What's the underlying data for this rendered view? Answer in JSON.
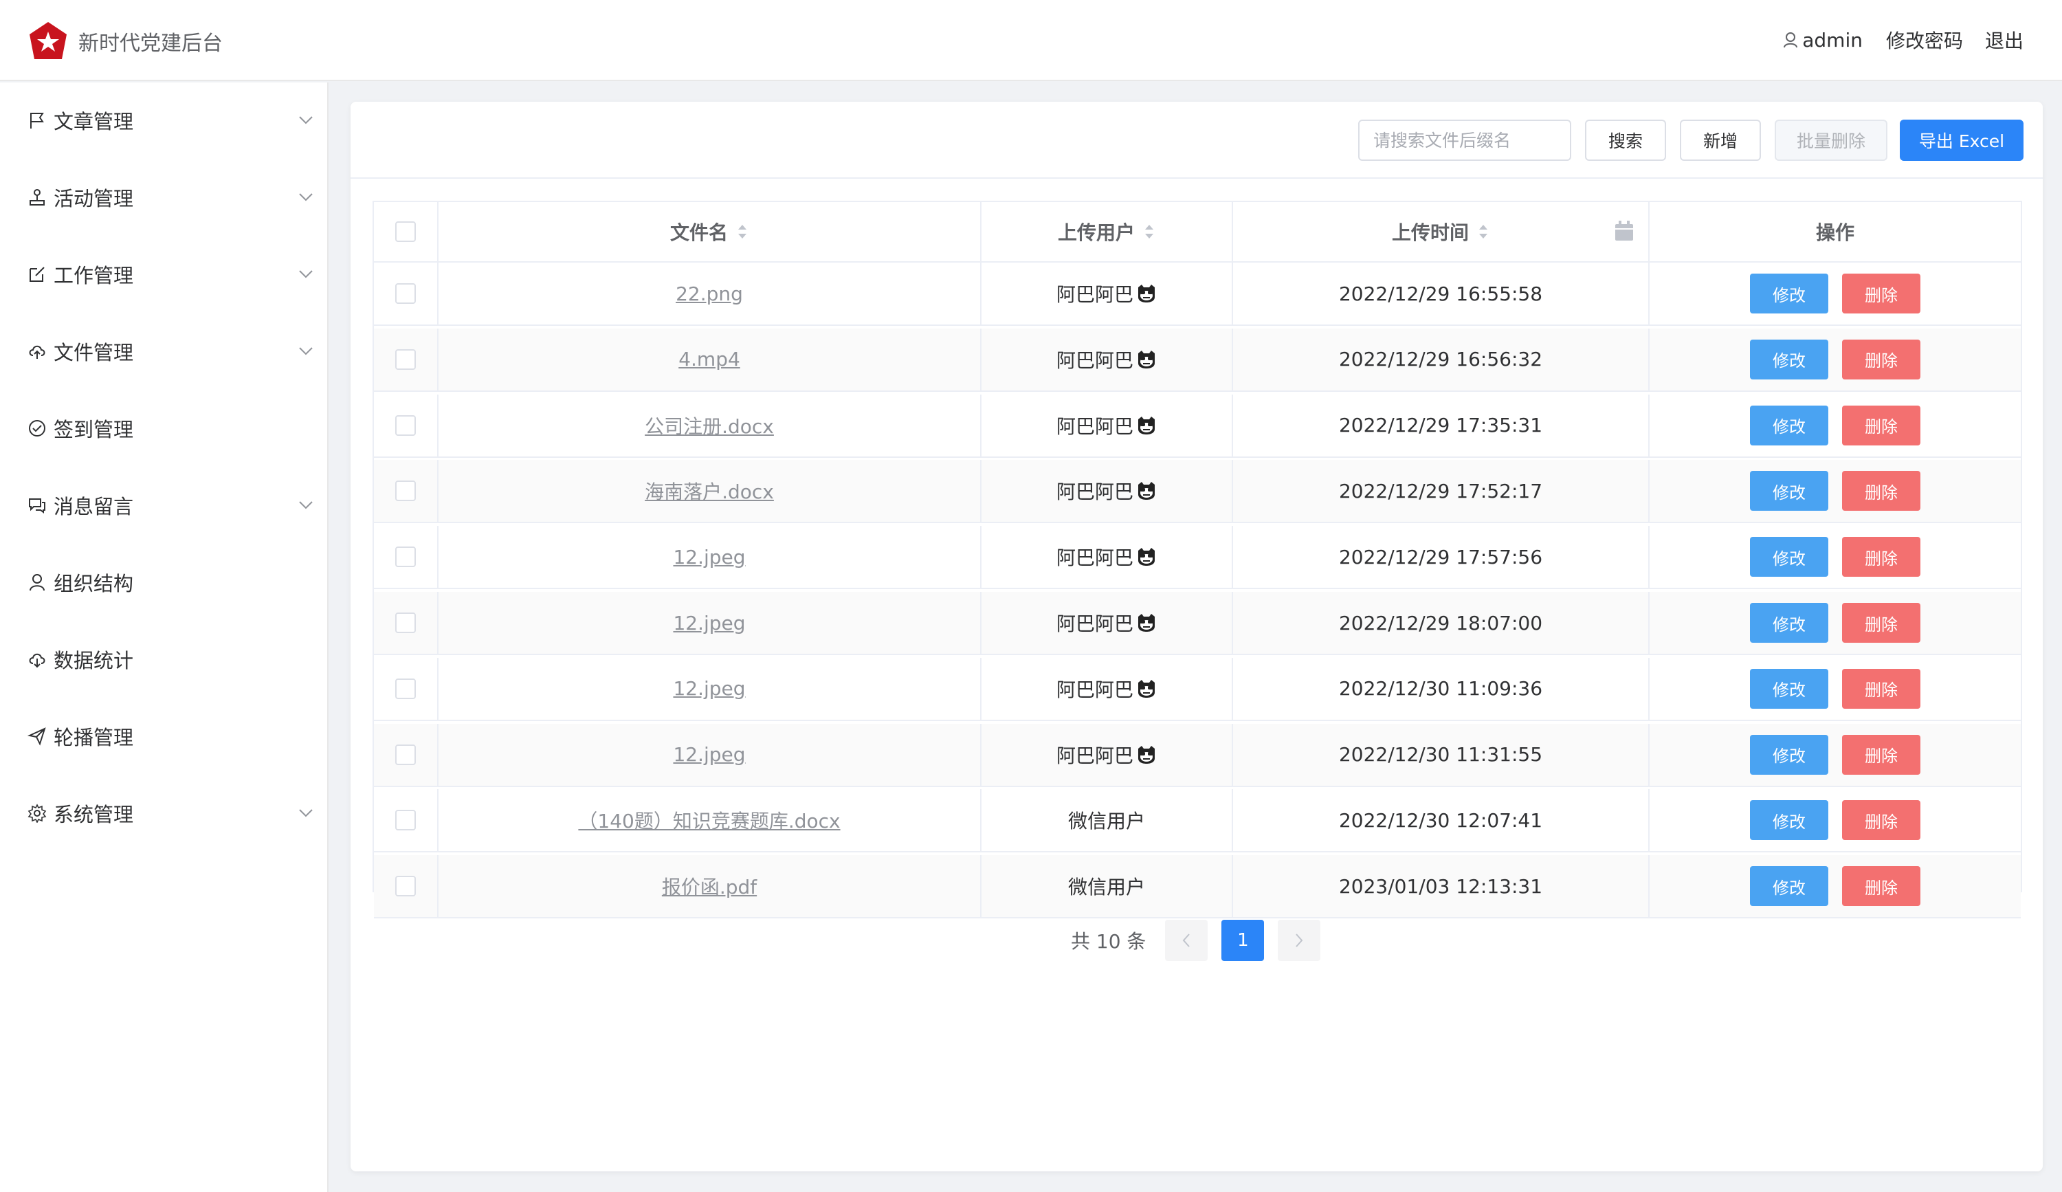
{
  "header": {
    "app_title": "新时代党建后台",
    "username": "admin",
    "change_password": "修改密码",
    "logout": "退出",
    "logo_color": "#c8141e"
  },
  "sidebar": {
    "items": [
      {
        "label": "文章管理",
        "icon": "flag-icon",
        "expandable": true
      },
      {
        "label": "活动管理",
        "icon": "joystick-icon",
        "expandable": true
      },
      {
        "label": "工作管理",
        "icon": "edit-icon",
        "expandable": true
      },
      {
        "label": "文件管理",
        "icon": "cloud-upload-icon",
        "expandable": true
      },
      {
        "label": "签到管理",
        "icon": "check-circle-icon",
        "expandable": false
      },
      {
        "label": "消息留言",
        "icon": "chat-icon",
        "expandable": true
      },
      {
        "label": "组织结构",
        "icon": "user-icon",
        "expandable": false
      },
      {
        "label": "数据统计",
        "icon": "cloud-download-icon",
        "expandable": false
      },
      {
        "label": "轮播管理",
        "icon": "send-icon",
        "expandable": false
      },
      {
        "label": "系统管理",
        "icon": "gear-icon",
        "expandable": true
      }
    ]
  },
  "toolbar": {
    "search_placeholder": "请搜索文件后缀名",
    "search_label": "搜索",
    "add_label": "新增",
    "batch_delete_label": "批量删除",
    "export_label": "导出 Excel"
  },
  "table": {
    "columns": {
      "name": "文件名",
      "user": "上传用户",
      "time": "上传时间",
      "ops": "操作"
    },
    "edit_label": "修改",
    "delete_label": "删除",
    "rows": [
      {
        "name": "22.png",
        "user": "阿巴阿巴",
        "emoji": true,
        "time": "2022/12/29 16:55:58"
      },
      {
        "name": "4.mp4",
        "user": "阿巴阿巴",
        "emoji": true,
        "time": "2022/12/29 16:56:32"
      },
      {
        "name": "公司注册.docx",
        "user": "阿巴阿巴",
        "emoji": true,
        "time": "2022/12/29 17:35:31"
      },
      {
        "name": "海南落户.docx",
        "user": "阿巴阿巴",
        "emoji": true,
        "time": "2022/12/29 17:52:17"
      },
      {
        "name": "12.jpeg",
        "user": "阿巴阿巴",
        "emoji": true,
        "time": "2022/12/29 17:57:56"
      },
      {
        "name": "12.jpeg",
        "user": "阿巴阿巴",
        "emoji": true,
        "time": "2022/12/29 18:07:00"
      },
      {
        "name": "12.jpeg",
        "user": "阿巴阿巴",
        "emoji": true,
        "time": "2022/12/30 11:09:36"
      },
      {
        "name": "12.jpeg",
        "user": "阿巴阿巴",
        "emoji": true,
        "time": "2022/12/30 11:31:55"
      },
      {
        "name": "（140题）知识竞赛题库.docx",
        "user": "微信用户",
        "emoji": false,
        "time": "2022/12/30 12:07:41"
      },
      {
        "name": "报价函.pdf",
        "user": "微信用户",
        "emoji": false,
        "time": "2023/01/03 12:13:31"
      }
    ]
  },
  "pagination": {
    "total_text": "共 10 条",
    "current_page": "1"
  },
  "colors": {
    "primary": "#2b85f8",
    "edit": "#4aa3f2",
    "delete": "#f37070"
  }
}
